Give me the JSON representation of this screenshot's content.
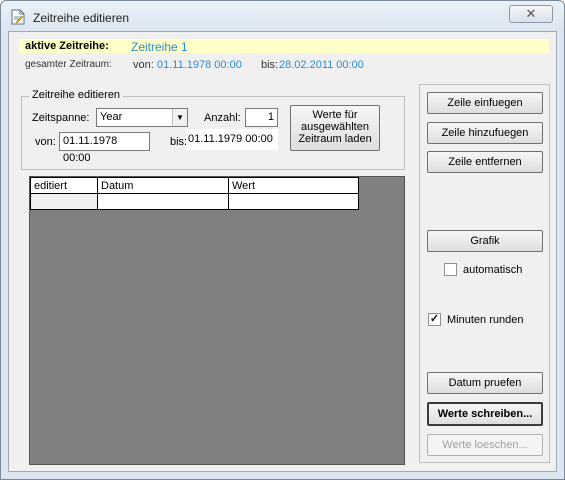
{
  "window": {
    "title": "Zeitreihe editieren",
    "close_symbol": "✕"
  },
  "header": {
    "active_label": "aktive Zeitreihe:",
    "active_value": "Zeitreihe 1",
    "range_label": "gesamter Zeitraum:",
    "from_label": "von:",
    "from_value": "01.11.1978 00:00",
    "to_label": "bis:",
    "to_value": "28.02.2011 00:00"
  },
  "group": {
    "title": "Zeitreihe editieren",
    "span_label": "Zeitspanne:",
    "span_value": "Year",
    "count_label": "Anzahl:",
    "count_value": "1",
    "from_label": "von:",
    "from_value": "01.11.1978 00:00",
    "to_label": "bis:",
    "to_value": "01.11.1979 00:00",
    "load_button_line1": "Werte für",
    "load_button_line2": "ausgewählten",
    "load_button_line3": "Zeitraum laden"
  },
  "grid": {
    "columns": [
      "editiert",
      "Datum",
      "Wert"
    ],
    "rows": [
      [
        "",
        "",
        ""
      ]
    ]
  },
  "buttons": {
    "insert_row": "Zeile einfuegen",
    "add_row": "Zeile hinzufuegen",
    "remove_row": "Zeile entfernen",
    "graph": "Grafik",
    "auto_label": "automatisch",
    "auto_checked": false,
    "round_label": "Minuten runden",
    "round_checked": true,
    "check_dates": "Datum pruefen",
    "write_values": "Werte schreiben...",
    "delete_values": "Werte loeschen..."
  },
  "colors": {
    "highlight_value": "#2a8bd0",
    "active_band": "#ffffc8",
    "grid_background": "#808080"
  },
  "icons": {
    "title": "document-edit-icon",
    "close": "close-icon",
    "dropdown": "chevron-down-icon",
    "check": "check-icon"
  }
}
